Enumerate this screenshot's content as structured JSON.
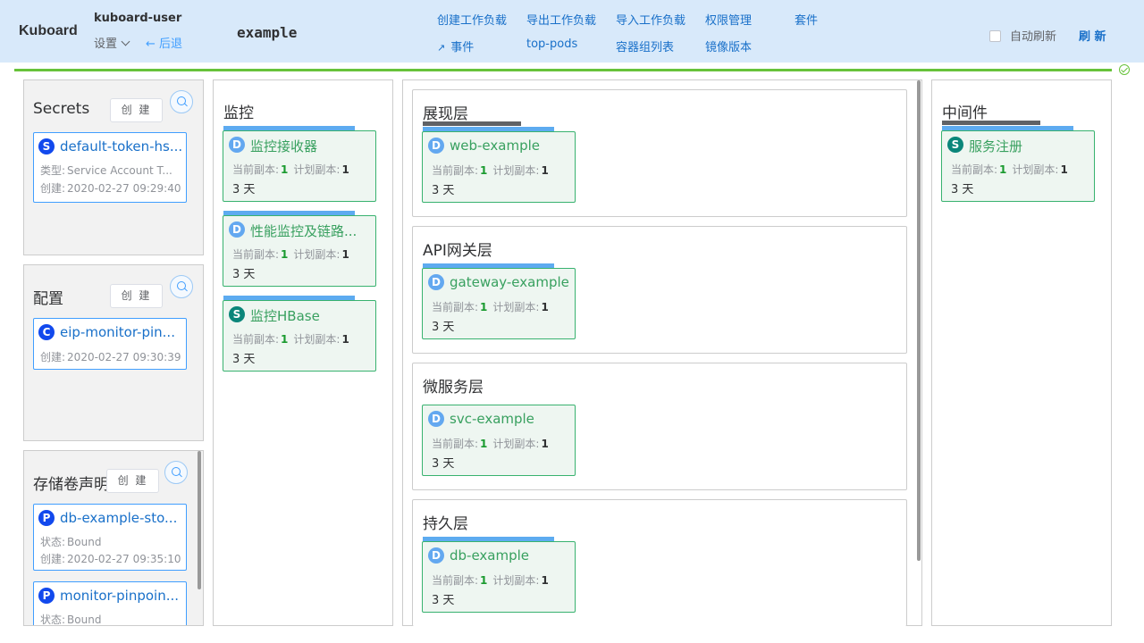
{
  "header": {
    "logo": "Kuboard",
    "user": "kuboard-user",
    "settings_label": "设置",
    "back_label": "← 后退",
    "namespace": "example",
    "nav": {
      "create_workload": "创建工作负载",
      "export_workload": "导出工作负载",
      "import_workload": "导入工作负载",
      "permissions": "权限管理",
      "suite": "套件",
      "events": "事件",
      "top_pods": "top-pods",
      "container_groups": "容器组列表",
      "image_versions": "镜像版本"
    },
    "auto_refresh_label": "自动刷新",
    "auto_refresh_checked": false,
    "refresh_label": "刷 新"
  },
  "common": {
    "create_label": "创 建",
    "current_replicas_label": "当前副本:",
    "planned_replicas_label": "计划副本:"
  },
  "secrets_panel": {
    "title": "Secrets",
    "items": [
      {
        "badge": "S",
        "name": "default-token-hs...",
        "type_label": "类型:",
        "type": "Service Account T...",
        "created_label": "创建:",
        "created": "2020-02-27 09:29:40"
      }
    ]
  },
  "config_panel": {
    "title": "配置",
    "items": [
      {
        "badge": "C",
        "name": "eip-monitor-pin...",
        "created_label": "创建:",
        "created": "2020-02-27 09:30:39"
      }
    ]
  },
  "pvc_panel": {
    "title": "存储卷声明",
    "items": [
      {
        "badge": "P",
        "name": "db-example-sto...",
        "status_label": "状态:",
        "status": "Bound",
        "created_label": "创建:",
        "created": "2020-02-27 09:35:10"
      },
      {
        "badge": "P",
        "name": "monitor-pinpoin...",
        "status_label": "状态:",
        "status": "Bound"
      }
    ]
  },
  "monitor_column": {
    "title": "监控",
    "items": [
      {
        "badge": "D",
        "name": "监控接收器",
        "current": "1",
        "planned": "1",
        "age": "3 天"
      },
      {
        "badge": "D",
        "name": "性能监控及链路...",
        "current": "1",
        "planned": "1",
        "age": "3 天"
      },
      {
        "badge": "S",
        "name": "监控HBase",
        "current": "1",
        "planned": "1",
        "age": "3 天"
      }
    ]
  },
  "layers": [
    {
      "title": "展现层",
      "workload": {
        "badge": "D",
        "name": "web-example",
        "current": "1",
        "planned": "1",
        "age": "3 天"
      }
    },
    {
      "title": "API网关层",
      "workload": {
        "badge": "D",
        "name": "gateway-example",
        "current": "1",
        "planned": "1",
        "age": "3 天"
      }
    },
    {
      "title": "微服务层",
      "workload": {
        "badge": "D",
        "name": "svc-example",
        "current": "1",
        "planned": "1",
        "age": "3 天"
      }
    },
    {
      "title": "持久层",
      "workload": {
        "badge": "D",
        "name": "db-example",
        "current": "1",
        "planned": "1",
        "age": "3 天"
      }
    }
  ],
  "middleware_column": {
    "title": "中间件",
    "items": [
      {
        "badge": "S",
        "name": "服务注册",
        "current": "1",
        "planned": "1",
        "age": "3 天"
      }
    ]
  },
  "colors": {
    "header_bg": "#d8e9fa",
    "link": "#1970c9",
    "workload_border": "#38b26f",
    "workload_bg": "#eef6f1",
    "deployment_badge": "#63a8f0",
    "statefulset_badge": "#0b867a",
    "resource_badge": "#1249ed",
    "progress": "#67c23a"
  }
}
